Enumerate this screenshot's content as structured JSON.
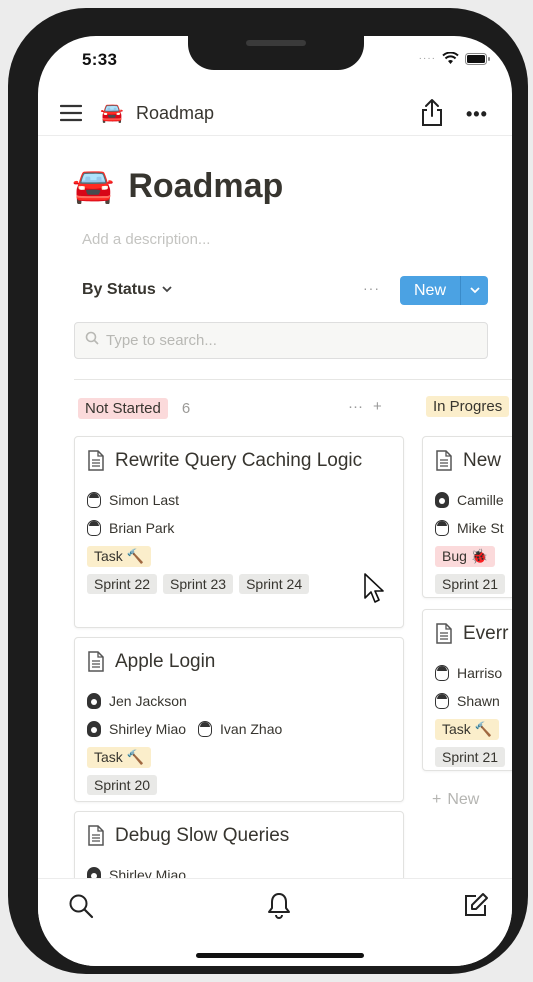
{
  "status_bar": {
    "time": "5:33",
    "signal": "····"
  },
  "nav": {
    "emoji": "🚘",
    "title": "Roadmap",
    "more": "•••"
  },
  "page": {
    "emoji": "🚘",
    "title": "Roadmap",
    "description_placeholder": "Add a description..."
  },
  "toolbar": {
    "view_label": "By Status",
    "view_chevron": "⌄",
    "more": "···",
    "new_label": "New",
    "new_chevron": "⌄"
  },
  "search": {
    "placeholder": "Type to search..."
  },
  "columns": [
    {
      "name": "Not Started",
      "count": "6",
      "more": "···",
      "add": "+",
      "color": "#fbdadb",
      "cards": [
        {
          "title": "Rewrite Query Caching Logic",
          "people": [
            "Simon Last",
            "Brian Park"
          ],
          "type": "Task 🔨",
          "sprints": [
            "Sprint 22",
            "Sprint 23",
            "Sprint 24"
          ]
        },
        {
          "title": "Apple Login",
          "people": [
            "Jen Jackson",
            "Shirley Miao",
            "Ivan Zhao"
          ],
          "type": "Task 🔨",
          "sprints": [
            "Sprint 20"
          ]
        },
        {
          "title": "Debug Slow Queries",
          "people": [
            "Shirley Miao"
          ]
        }
      ]
    },
    {
      "name": "In Progres",
      "color": "#fbeecb",
      "new_label": "New",
      "new_icon": "+",
      "cards": [
        {
          "title": "New",
          "people": [
            "Camille",
            "Mike St"
          ],
          "type": "Bug 🐞",
          "sprints": [
            "Sprint 21"
          ]
        },
        {
          "title": "Everr",
          "people": [
            "Harriso",
            "Shawn"
          ],
          "type": "Task 🔨",
          "sprints": [
            "Sprint 21"
          ]
        }
      ]
    }
  ],
  "colors": {
    "accent": "#4ba2e3",
    "text": "#37352f",
    "phone_frame": "#1c1c1c"
  }
}
